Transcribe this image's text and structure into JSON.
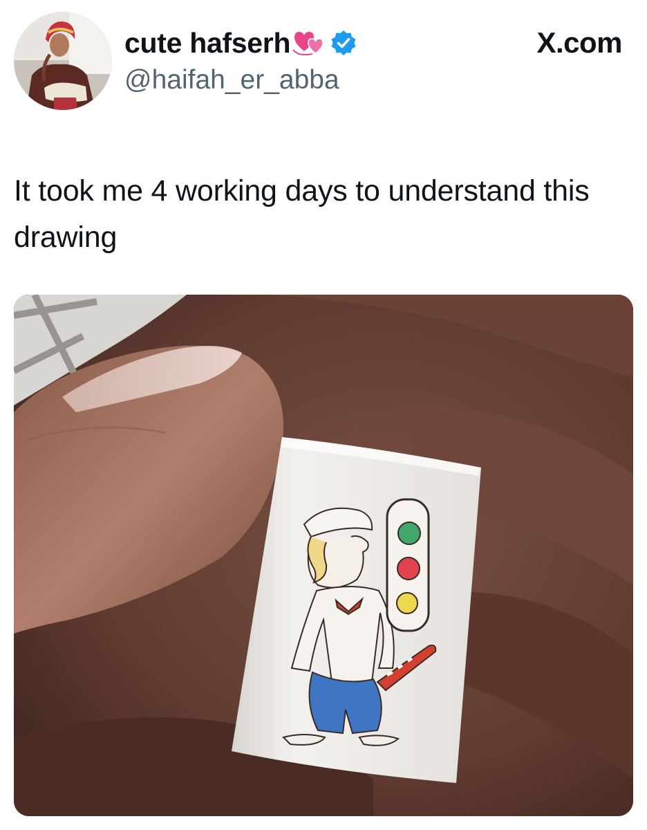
{
  "tweet": {
    "display_name": "cute hafserh",
    "handle": "@haifah_er_abba",
    "site": "X.com",
    "text": "It took me 4 working days to understand this drawing",
    "verified": true,
    "name_emoji": "revolving-hearts-icon"
  },
  "colors": {
    "verified_badge": "#1d9bf0",
    "text_primary": "#0f1419",
    "text_secondary": "#536471",
    "hearts": "#e8458b"
  }
}
